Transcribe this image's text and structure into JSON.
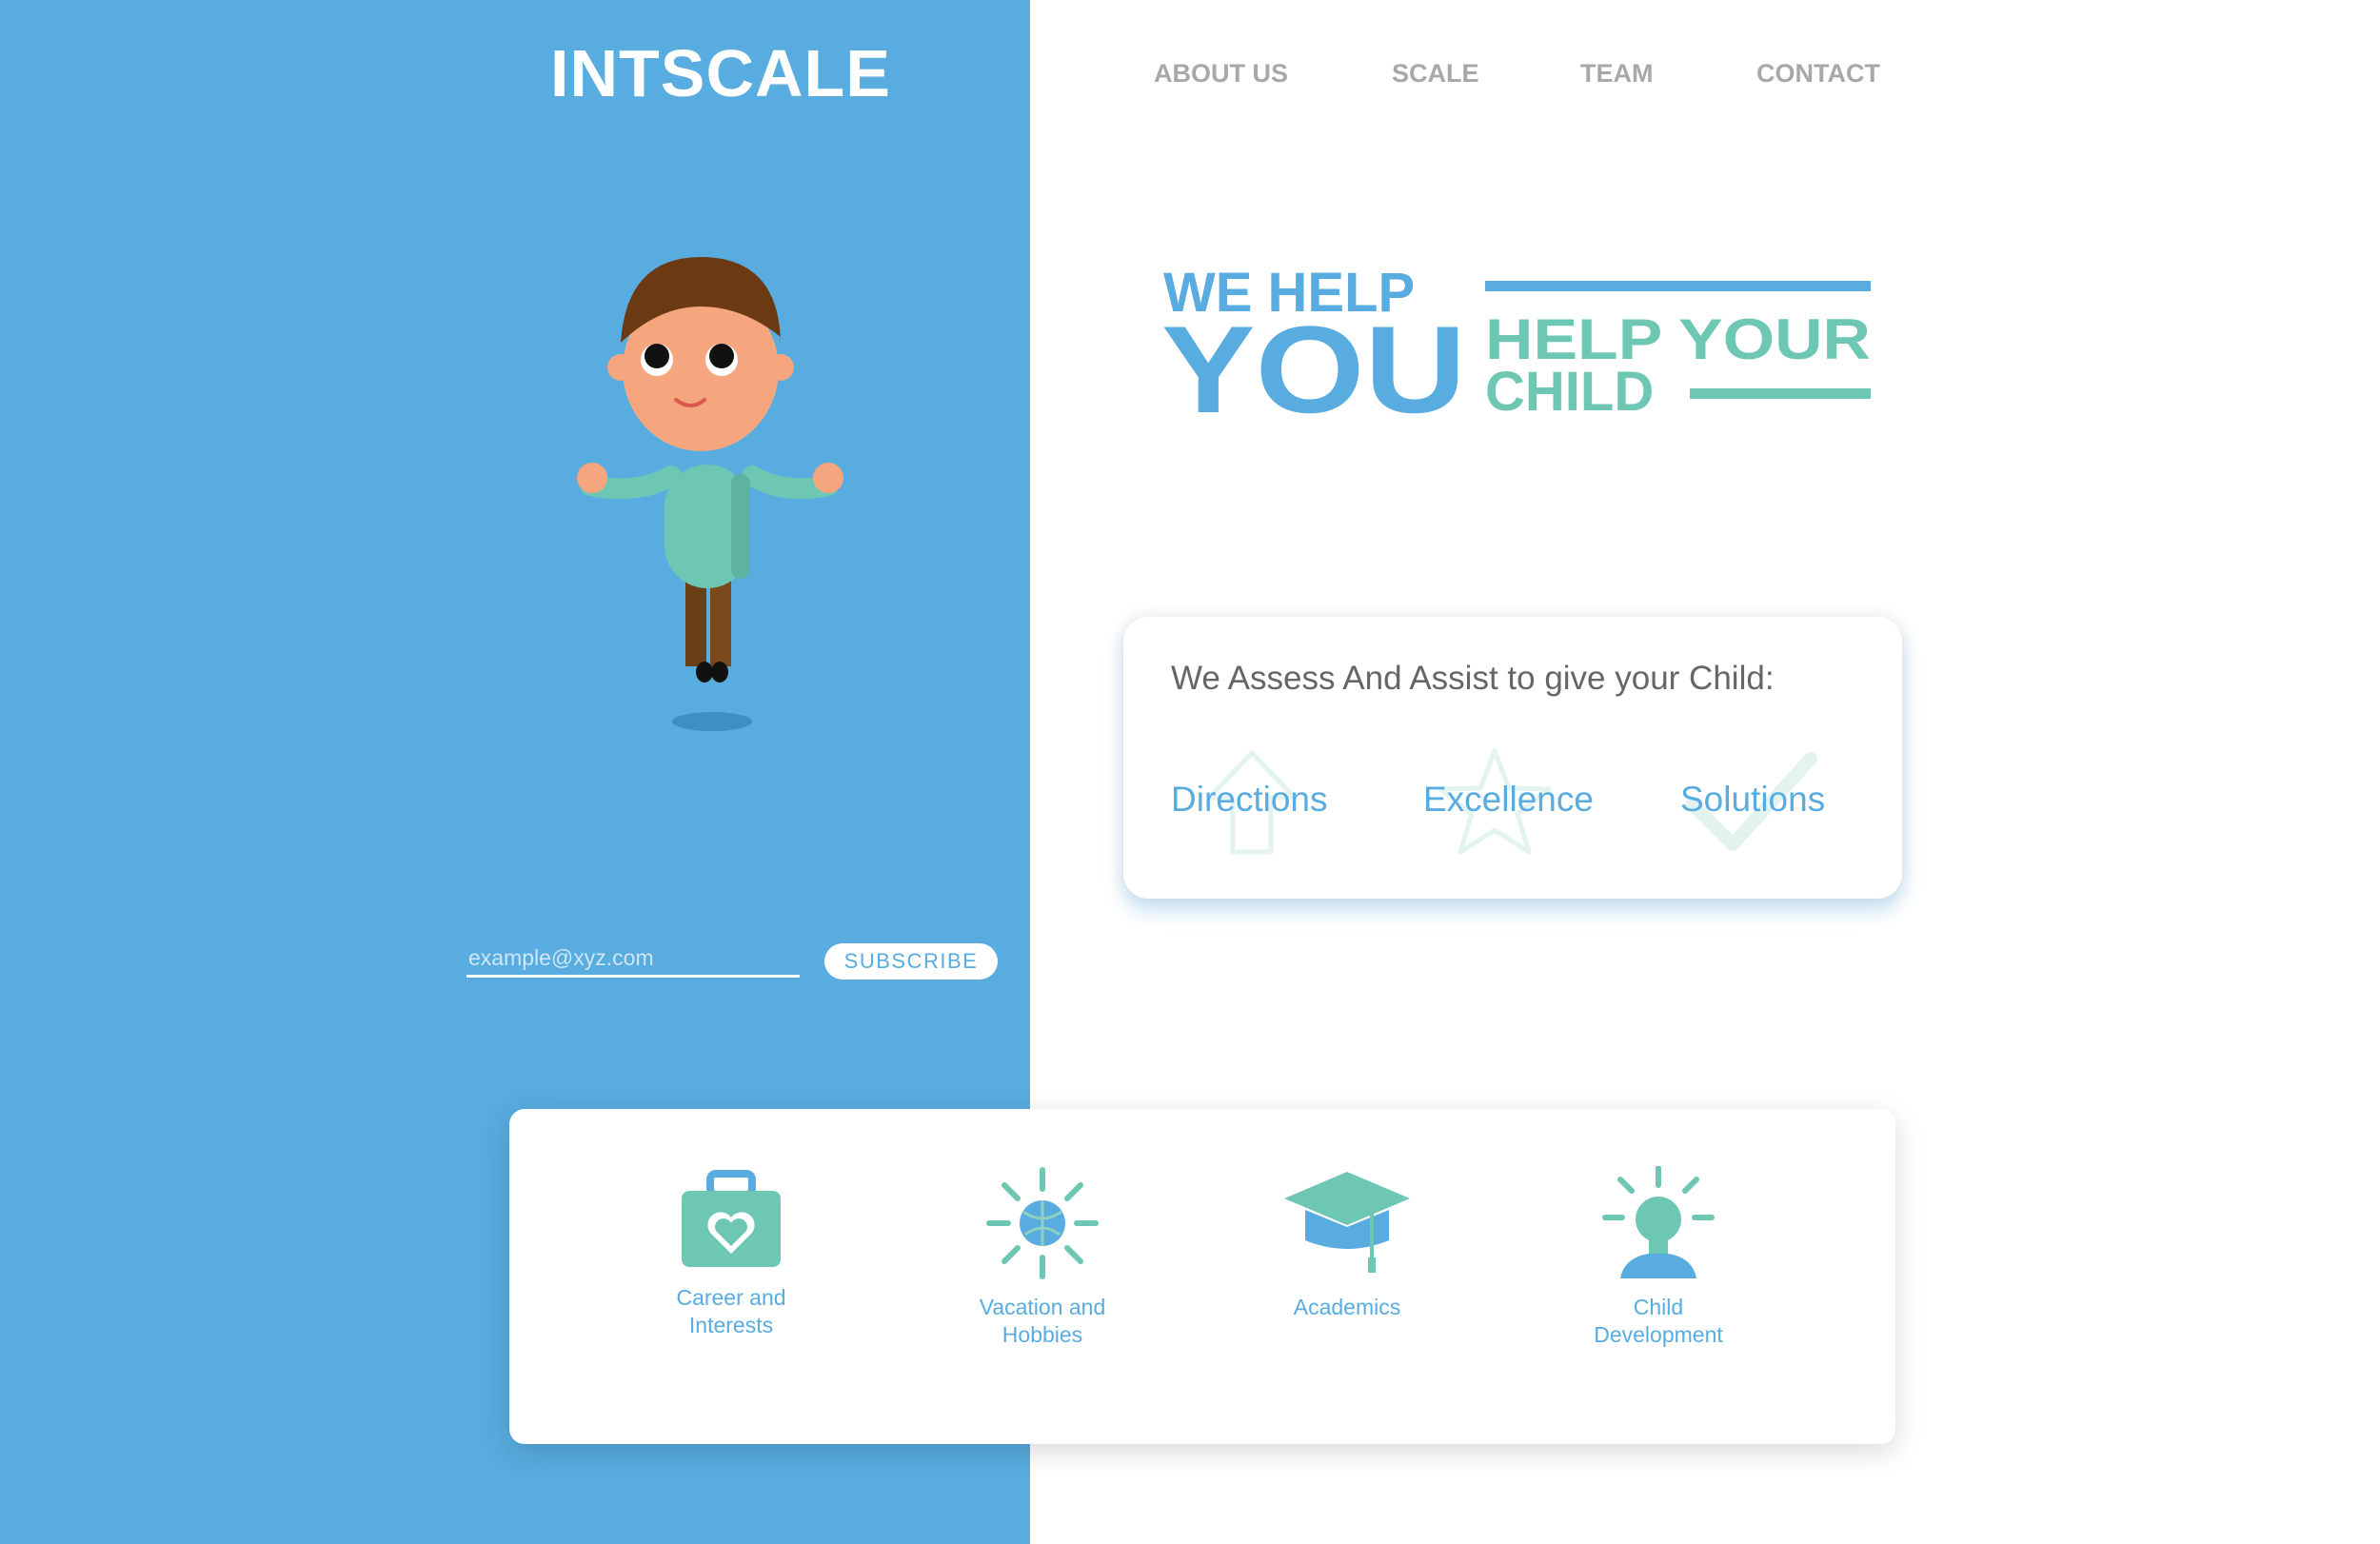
{
  "header": {
    "brand": "INTSCALE",
    "nav": [
      "ABOUT US",
      "SCALE",
      "TEAM",
      "CONTACT"
    ]
  },
  "hero": {
    "line1": "WE HELP",
    "big": "YOU",
    "line2": "HELP YOUR",
    "line3": "CHILD"
  },
  "subscribe": {
    "placeholder": "example@xyz.com",
    "button": "SUBSCRIBE"
  },
  "assess": {
    "title": "We Assess And Assist to give your Child:",
    "items": [
      "Directions",
      "Excellence",
      "Solutions"
    ]
  },
  "services": [
    {
      "label_line1": "Career and",
      "label_line2": "Interests",
      "icon": "briefcase-heart-icon"
    },
    {
      "label_line1": "Vacation and",
      "label_line2": "Hobbies",
      "icon": "sun-ball-icon"
    },
    {
      "label_line1": "Academics",
      "label_line2": "",
      "icon": "graduation-cap-icon"
    },
    {
      "label_line1": "Child",
      "label_line2": "Development",
      "icon": "lightbulb-person-icon"
    }
  ],
  "colors": {
    "primary_blue": "#58acdf",
    "teal": "#6dc7b3",
    "nav_gray": "#a8a8a8",
    "text_gray": "#666666"
  }
}
